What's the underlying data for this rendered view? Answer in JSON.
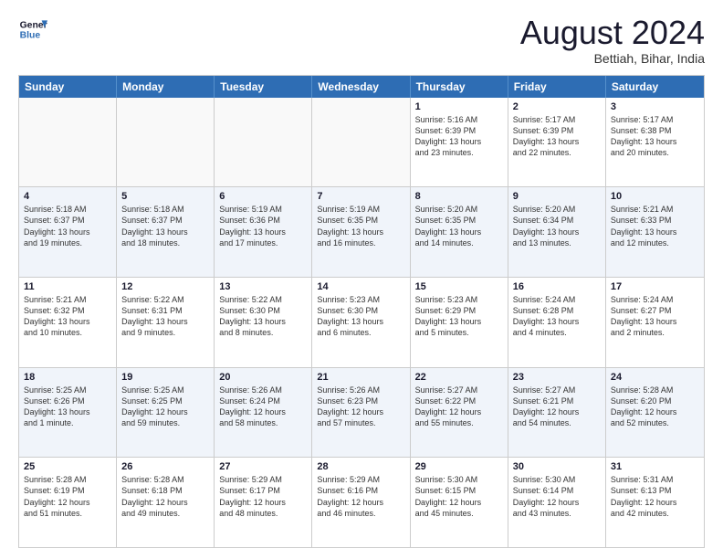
{
  "header": {
    "logo_line1": "General",
    "logo_line2": "Blue",
    "month": "August 2024",
    "location": "Bettiah, Bihar, India"
  },
  "weekdays": [
    "Sunday",
    "Monday",
    "Tuesday",
    "Wednesday",
    "Thursday",
    "Friday",
    "Saturday"
  ],
  "rows": [
    [
      {
        "day": "",
        "text": ""
      },
      {
        "day": "",
        "text": ""
      },
      {
        "day": "",
        "text": ""
      },
      {
        "day": "",
        "text": ""
      },
      {
        "day": "1",
        "text": "Sunrise: 5:16 AM\nSunset: 6:39 PM\nDaylight: 13 hours\nand 23 minutes."
      },
      {
        "day": "2",
        "text": "Sunrise: 5:17 AM\nSunset: 6:39 PM\nDaylight: 13 hours\nand 22 minutes."
      },
      {
        "day": "3",
        "text": "Sunrise: 5:17 AM\nSunset: 6:38 PM\nDaylight: 13 hours\nand 20 minutes."
      }
    ],
    [
      {
        "day": "4",
        "text": "Sunrise: 5:18 AM\nSunset: 6:37 PM\nDaylight: 13 hours\nand 19 minutes."
      },
      {
        "day": "5",
        "text": "Sunrise: 5:18 AM\nSunset: 6:37 PM\nDaylight: 13 hours\nand 18 minutes."
      },
      {
        "day": "6",
        "text": "Sunrise: 5:19 AM\nSunset: 6:36 PM\nDaylight: 13 hours\nand 17 minutes."
      },
      {
        "day": "7",
        "text": "Sunrise: 5:19 AM\nSunset: 6:35 PM\nDaylight: 13 hours\nand 16 minutes."
      },
      {
        "day": "8",
        "text": "Sunrise: 5:20 AM\nSunset: 6:35 PM\nDaylight: 13 hours\nand 14 minutes."
      },
      {
        "day": "9",
        "text": "Sunrise: 5:20 AM\nSunset: 6:34 PM\nDaylight: 13 hours\nand 13 minutes."
      },
      {
        "day": "10",
        "text": "Sunrise: 5:21 AM\nSunset: 6:33 PM\nDaylight: 13 hours\nand 12 minutes."
      }
    ],
    [
      {
        "day": "11",
        "text": "Sunrise: 5:21 AM\nSunset: 6:32 PM\nDaylight: 13 hours\nand 10 minutes."
      },
      {
        "day": "12",
        "text": "Sunrise: 5:22 AM\nSunset: 6:31 PM\nDaylight: 13 hours\nand 9 minutes."
      },
      {
        "day": "13",
        "text": "Sunrise: 5:22 AM\nSunset: 6:30 PM\nDaylight: 13 hours\nand 8 minutes."
      },
      {
        "day": "14",
        "text": "Sunrise: 5:23 AM\nSunset: 6:30 PM\nDaylight: 13 hours\nand 6 minutes."
      },
      {
        "day": "15",
        "text": "Sunrise: 5:23 AM\nSunset: 6:29 PM\nDaylight: 13 hours\nand 5 minutes."
      },
      {
        "day": "16",
        "text": "Sunrise: 5:24 AM\nSunset: 6:28 PM\nDaylight: 13 hours\nand 4 minutes."
      },
      {
        "day": "17",
        "text": "Sunrise: 5:24 AM\nSunset: 6:27 PM\nDaylight: 13 hours\nand 2 minutes."
      }
    ],
    [
      {
        "day": "18",
        "text": "Sunrise: 5:25 AM\nSunset: 6:26 PM\nDaylight: 13 hours\nand 1 minute."
      },
      {
        "day": "19",
        "text": "Sunrise: 5:25 AM\nSunset: 6:25 PM\nDaylight: 12 hours\nand 59 minutes."
      },
      {
        "day": "20",
        "text": "Sunrise: 5:26 AM\nSunset: 6:24 PM\nDaylight: 12 hours\nand 58 minutes."
      },
      {
        "day": "21",
        "text": "Sunrise: 5:26 AM\nSunset: 6:23 PM\nDaylight: 12 hours\nand 57 minutes."
      },
      {
        "day": "22",
        "text": "Sunrise: 5:27 AM\nSunset: 6:22 PM\nDaylight: 12 hours\nand 55 minutes."
      },
      {
        "day": "23",
        "text": "Sunrise: 5:27 AM\nSunset: 6:21 PM\nDaylight: 12 hours\nand 54 minutes."
      },
      {
        "day": "24",
        "text": "Sunrise: 5:28 AM\nSunset: 6:20 PM\nDaylight: 12 hours\nand 52 minutes."
      }
    ],
    [
      {
        "day": "25",
        "text": "Sunrise: 5:28 AM\nSunset: 6:19 PM\nDaylight: 12 hours\nand 51 minutes."
      },
      {
        "day": "26",
        "text": "Sunrise: 5:28 AM\nSunset: 6:18 PM\nDaylight: 12 hours\nand 49 minutes."
      },
      {
        "day": "27",
        "text": "Sunrise: 5:29 AM\nSunset: 6:17 PM\nDaylight: 12 hours\nand 48 minutes."
      },
      {
        "day": "28",
        "text": "Sunrise: 5:29 AM\nSunset: 6:16 PM\nDaylight: 12 hours\nand 46 minutes."
      },
      {
        "day": "29",
        "text": "Sunrise: 5:30 AM\nSunset: 6:15 PM\nDaylight: 12 hours\nand 45 minutes."
      },
      {
        "day": "30",
        "text": "Sunrise: 5:30 AM\nSunset: 6:14 PM\nDaylight: 12 hours\nand 43 minutes."
      },
      {
        "day": "31",
        "text": "Sunrise: 5:31 AM\nSunset: 6:13 PM\nDaylight: 12 hours\nand 42 minutes."
      }
    ]
  ]
}
